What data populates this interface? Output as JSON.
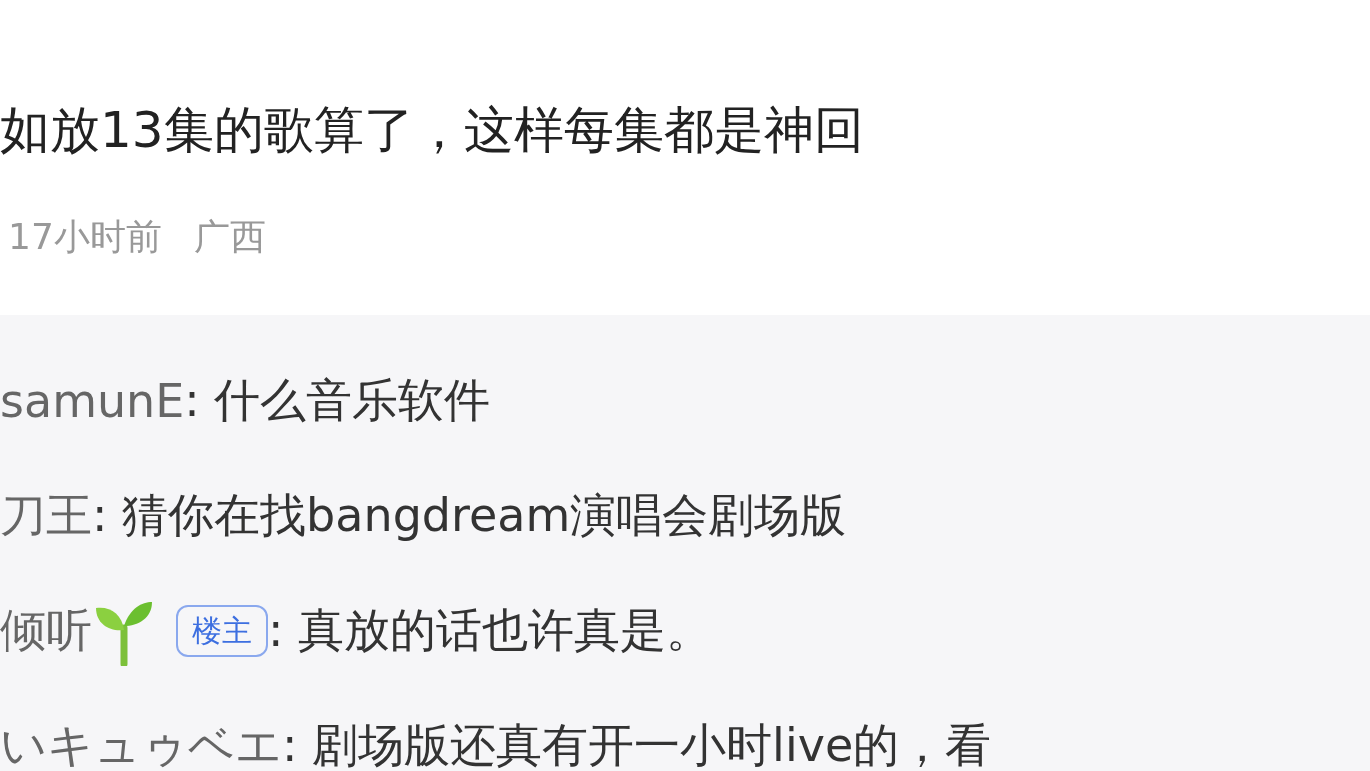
{
  "comment": {
    "text": "如放13集的歌算了，这样每集都是神回",
    "time": "17小时前",
    "location": "广西"
  },
  "replies": [
    {
      "name": "samunE",
      "sprout": false,
      "text": ": 什么音乐软件"
    },
    {
      "name": "刀王",
      "sprout": false,
      "text": ": 猜你在找bangdream演唱会剧场版"
    },
    {
      "name": "倾听",
      "sprout": true,
      "badge": "楼主",
      "text": ": 真放的话也许真是。"
    },
    {
      "name": "いキュゥベエ",
      "sprout": false,
      "text": ": 剧场版还真有开一小时live的，看"
    }
  ]
}
